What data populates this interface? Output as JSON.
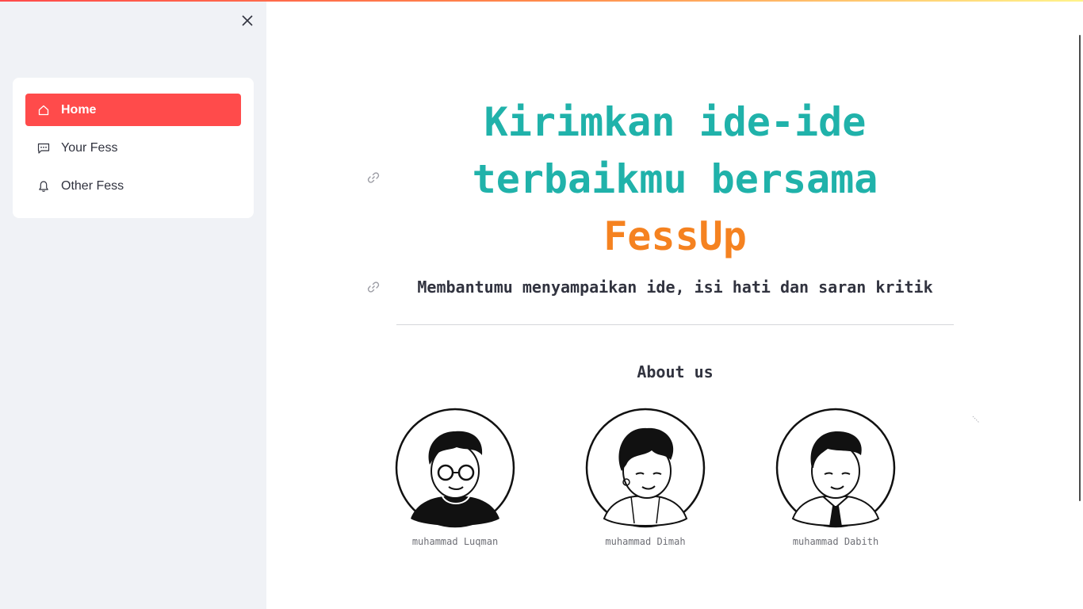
{
  "sidebar": {
    "items": [
      {
        "label": "Home",
        "icon": "home-icon",
        "active": true
      },
      {
        "label": "Your Fess",
        "icon": "chat-icon",
        "active": false
      },
      {
        "label": "Other Fess",
        "icon": "bell-icon",
        "active": false
      }
    ]
  },
  "hero": {
    "title_line1": "Kirimkan ide-ide",
    "title_line2": "terbaikmu bersama",
    "title_accent": "FessUp",
    "subtitle": "Membantumu menyampaikan ide, isi hati dan saran kritik"
  },
  "about": {
    "title": "About us",
    "members": [
      {
        "name": "muhammad Luqman"
      },
      {
        "name": "muhammad Dimah"
      },
      {
        "name": "muhammad Dabith"
      }
    ]
  },
  "colors": {
    "accent": "#ff4b4b",
    "title_teal": "#20b2aa",
    "title_orange": "#f58220",
    "sidebar_bg": "#f0f2f6"
  }
}
